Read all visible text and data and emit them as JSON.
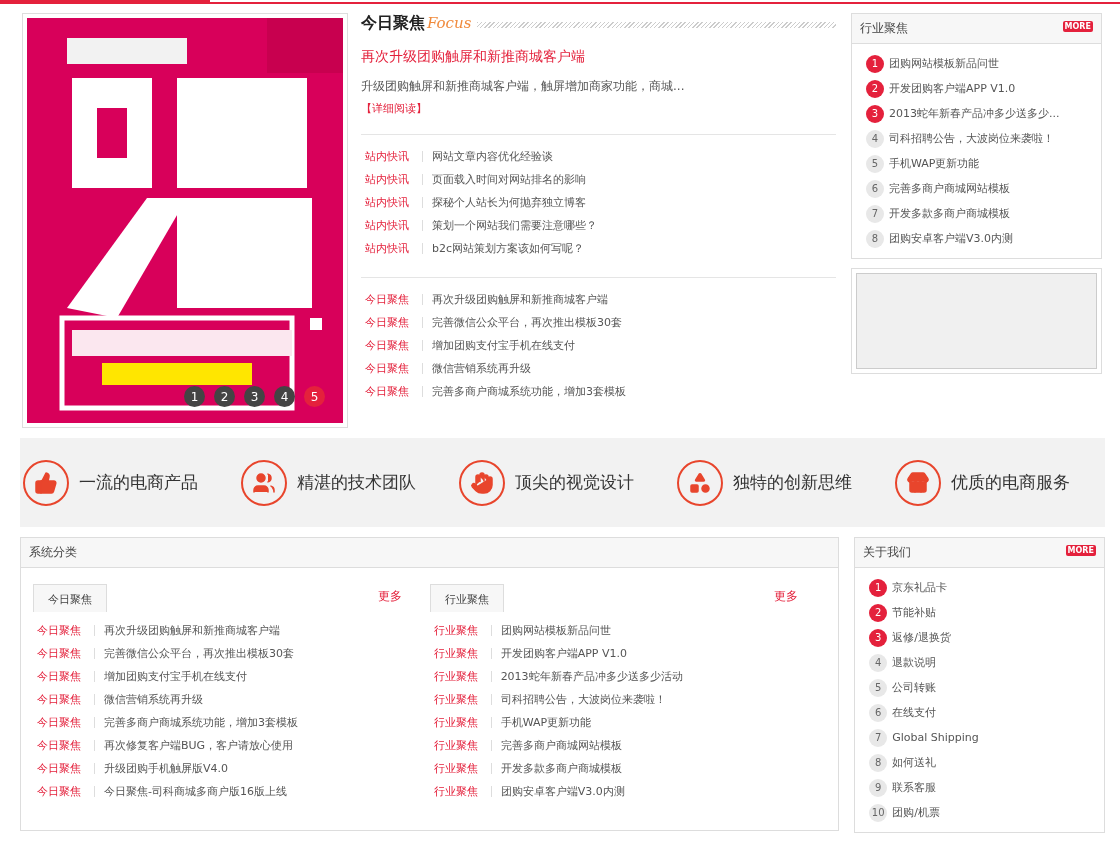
{
  "banner": {
    "dots": [
      {
        "label": "1",
        "selected": false
      },
      {
        "label": "2",
        "selected": false
      },
      {
        "label": "3",
        "selected": false
      },
      {
        "label": "4",
        "selected": false
      },
      {
        "label": "5",
        "selected": true
      }
    ]
  },
  "focus": {
    "title": "今日聚焦",
    "subtitle": "Focus",
    "headline": "再次升级团购触屏和新推商城客户端",
    "summary": "升级团购触屏和新推商城客户端，触屏增加商家功能，商城...",
    "read_more": "【详细阅读】",
    "groups": [
      [
        {
          "tag": "站内快讯",
          "text": "网站文章内容优化经验谈"
        },
        {
          "tag": "站内快讯",
          "text": "页面载入时间对网站排名的影响"
        },
        {
          "tag": "站内快讯",
          "text": "探秘个人站长为何抛弃独立博客"
        },
        {
          "tag": "站内快讯",
          "text": "策划一个网站我们需要注意哪些？"
        },
        {
          "tag": "站内快讯",
          "text": "b2c网站策划方案该如何写呢？"
        }
      ],
      [
        {
          "tag": "今日聚焦",
          "text": "再次升级团购触屏和新推商城客户端"
        },
        {
          "tag": "今日聚焦",
          "text": "完善微信公众平台，再次推出模板30套"
        },
        {
          "tag": "今日聚焦",
          "text": "增加团购支付宝手机在线支付"
        },
        {
          "tag": "今日聚焦",
          "text": "微信营销系统再升级"
        },
        {
          "tag": "今日聚焦",
          "text": "完善多商户商城系统功能，增加3套模板"
        }
      ]
    ]
  },
  "industry": {
    "title": "行业聚焦",
    "more": "MORE",
    "items": [
      {
        "rank": "1",
        "text": "团购网站模板新品问世",
        "highlight": true
      },
      {
        "rank": "2",
        "text": "开发团购客户端APP V1.0",
        "highlight": true
      },
      {
        "rank": "3",
        "text": "2013蛇年新春产品冲多少送多少...",
        "highlight": true
      },
      {
        "rank": "4",
        "text": "司科招聘公告，大波岗位来袭啦！",
        "highlight": false
      },
      {
        "rank": "5",
        "text": "手机WAP更新功能",
        "highlight": false
      },
      {
        "rank": "6",
        "text": "完善多商户商城网站模板",
        "highlight": false
      },
      {
        "rank": "7",
        "text": "开发多款多商户商城模板",
        "highlight": false
      },
      {
        "rank": "8",
        "text": "团购安卓客户端V3.0内测",
        "highlight": false
      }
    ]
  },
  "features": [
    {
      "label": "一流的电商产品"
    },
    {
      "label": "精湛的技术团队"
    },
    {
      "label": "顶尖的视觉设计"
    },
    {
      "label": "独特的创新思维"
    },
    {
      "label": "优质的电商服务"
    }
  ],
  "categories": {
    "title": "系统分类",
    "columns": [
      {
        "tab": "今日聚焦",
        "more": "更多",
        "rows": [
          {
            "tag": "今日聚焦",
            "text": "再次升级团购触屏和新推商城客户端"
          },
          {
            "tag": "今日聚焦",
            "text": "完善微信公众平台，再次推出模板30套"
          },
          {
            "tag": "今日聚焦",
            "text": "增加团购支付宝手机在线支付"
          },
          {
            "tag": "今日聚焦",
            "text": "微信营销系统再升级"
          },
          {
            "tag": "今日聚焦",
            "text": "完善多商户商城系统功能，增加3套模板"
          },
          {
            "tag": "今日聚焦",
            "text": "再次修复客户端BUG，客户请放心使用"
          },
          {
            "tag": "今日聚焦",
            "text": "升级团购手机触屏版V4.0"
          },
          {
            "tag": "今日聚焦",
            "text": "今日聚焦-司科商城多商户版16版上线"
          }
        ]
      },
      {
        "tab": "行业聚焦",
        "more": "更多",
        "rows": [
          {
            "tag": "行业聚焦",
            "text": "团购网站模板新品问世"
          },
          {
            "tag": "行业聚焦",
            "text": "开发团购客户端APP V1.0"
          },
          {
            "tag": "行业聚焦",
            "text": "2013蛇年新春产品冲多少送多少活动"
          },
          {
            "tag": "行业聚焦",
            "text": "司科招聘公告，大波岗位来袭啦！"
          },
          {
            "tag": "行业聚焦",
            "text": "手机WAP更新功能"
          },
          {
            "tag": "行业聚焦",
            "text": "完善多商户商城网站模板"
          },
          {
            "tag": "行业聚焦",
            "text": "开发多款多商户商城模板"
          },
          {
            "tag": "行业聚焦",
            "text": "团购安卓客户端V3.0内测"
          }
        ]
      }
    ]
  },
  "about": {
    "title": "关于我们",
    "more": "MORE",
    "items": [
      {
        "rank": "1",
        "text": "京东礼品卡",
        "highlight": true
      },
      {
        "rank": "2",
        "text": "节能补贴",
        "highlight": true
      },
      {
        "rank": "3",
        "text": "返修/退换货",
        "highlight": true
      },
      {
        "rank": "4",
        "text": "退款说明",
        "highlight": false
      },
      {
        "rank": "5",
        "text": "公司转账",
        "highlight": false
      },
      {
        "rank": "6",
        "text": "在线支付",
        "highlight": false
      },
      {
        "rank": "7",
        "text": "Global Shipping",
        "highlight": false
      },
      {
        "rank": "8",
        "text": "如何送礼",
        "highlight": false
      },
      {
        "rank": "9",
        "text": "联系客服",
        "highlight": false
      },
      {
        "rank": "10",
        "text": "团购/机票",
        "highlight": false
      }
    ]
  }
}
